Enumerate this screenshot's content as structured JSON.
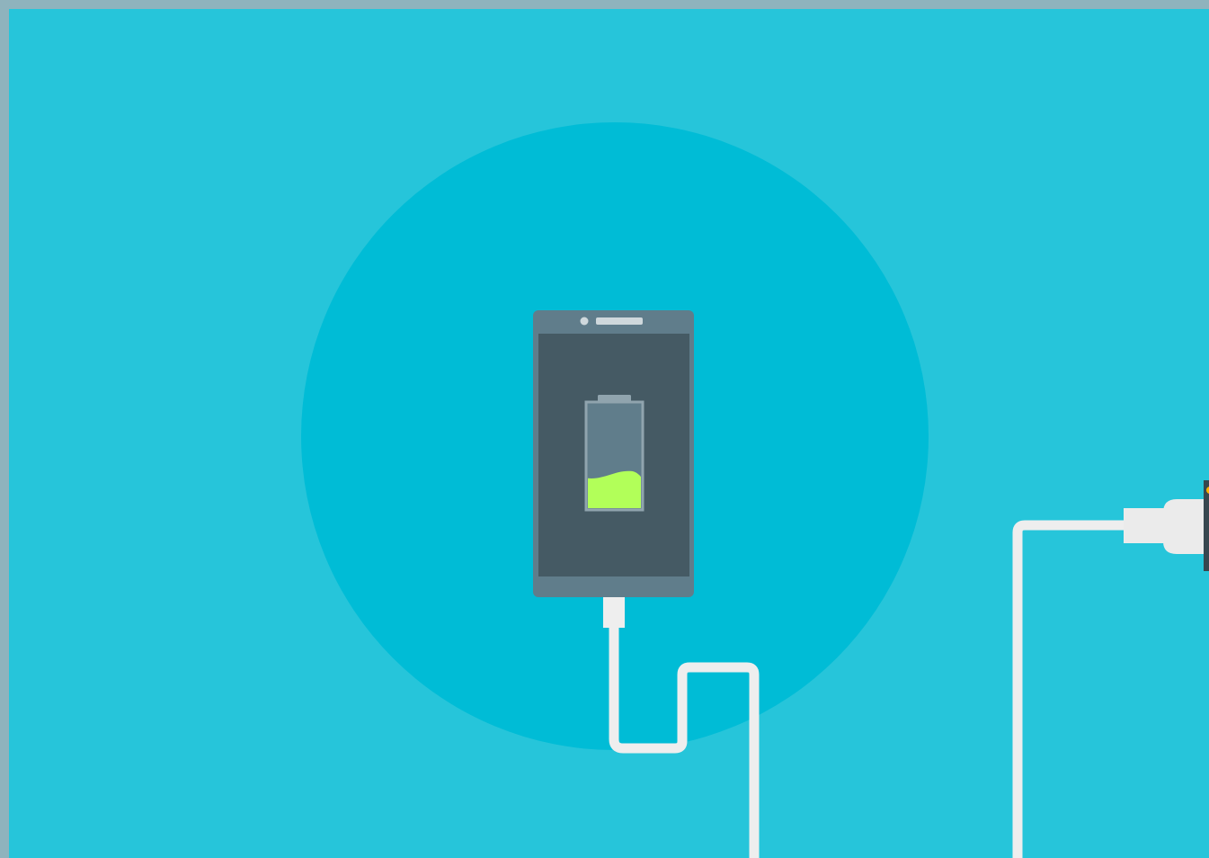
{
  "illustration": {
    "subject": "phone-charging",
    "icons": [
      "phone-icon",
      "battery-icon",
      "usb-cable-icon",
      "wall-adapter-icon"
    ],
    "battery_level": 0.3,
    "colors": {
      "frame": "#8fb3bd",
      "background": "#26c5da",
      "circle": "#00bcd6",
      "phone_body": "#607d8b",
      "phone_screen": "#455a64",
      "speaker": "#cfd8dc",
      "battery_shell": "#607d8b",
      "battery_outline": "#90a4ae",
      "battery_fill": "#b2ff59",
      "cable": "#eeeeee",
      "adapter_body": "#ebebeb",
      "socket": "#37474f",
      "socket_indicator": "#ffb300"
    }
  }
}
